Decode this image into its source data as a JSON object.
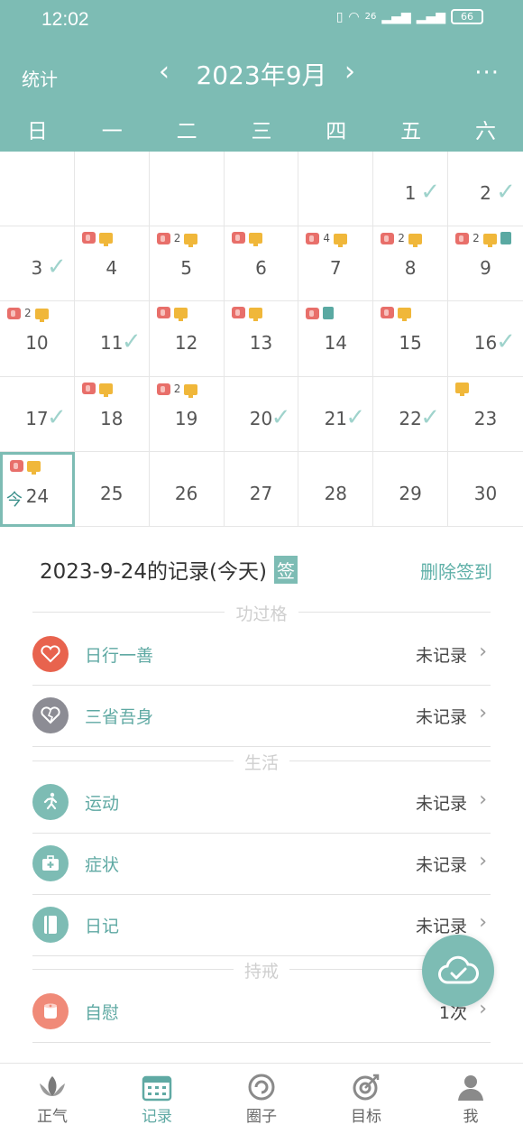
{
  "status_bar": {
    "time": "12:02",
    "signal": "26",
    "battery": "66"
  },
  "header": {
    "stats_label": "统计",
    "month_title": "2023年9月",
    "prev": "‹",
    "next": "›",
    "more": "···"
  },
  "weekdays": [
    "日",
    "一",
    "二",
    "三",
    "四",
    "五",
    "六"
  ],
  "calendar": {
    "days": [
      {
        "n": "",
        "check": false,
        "markers": []
      },
      {
        "n": "",
        "check": false,
        "markers": []
      },
      {
        "n": "",
        "check": false,
        "markers": []
      },
      {
        "n": "",
        "check": false,
        "markers": []
      },
      {
        "n": "",
        "check": false,
        "markers": []
      },
      {
        "n": "1",
        "check": true,
        "markers": []
      },
      {
        "n": "2",
        "check": true,
        "markers": []
      },
      {
        "n": "3",
        "check": true,
        "markers": []
      },
      {
        "n": "4",
        "check": false,
        "markers": [
          "red",
          "yellow"
        ]
      },
      {
        "n": "5",
        "check": false,
        "markers": [
          "red",
          "2",
          "yellow"
        ]
      },
      {
        "n": "6",
        "check": false,
        "markers": [
          "red",
          "yellow"
        ]
      },
      {
        "n": "7",
        "check": false,
        "markers": [
          "red",
          "4",
          "yellow"
        ]
      },
      {
        "n": "8",
        "check": false,
        "markers": [
          "red",
          "2",
          "yellow"
        ]
      },
      {
        "n": "9",
        "check": false,
        "markers": [
          "red",
          "2",
          "yellow",
          "teal"
        ]
      },
      {
        "n": "10",
        "check": false,
        "markers": [
          "red",
          "2",
          "yellow"
        ]
      },
      {
        "n": "11",
        "check": true,
        "markers": []
      },
      {
        "n": "12",
        "check": false,
        "markers": [
          "red",
          "yellow"
        ]
      },
      {
        "n": "13",
        "check": false,
        "markers": [
          "red",
          "yellow"
        ]
      },
      {
        "n": "14",
        "check": false,
        "markers": [
          "red",
          "teal"
        ]
      },
      {
        "n": "15",
        "check": false,
        "markers": [
          "red",
          "yellow"
        ]
      },
      {
        "n": "16",
        "check": true,
        "markers": []
      },
      {
        "n": "17",
        "check": true,
        "markers": []
      },
      {
        "n": "18",
        "check": false,
        "markers": [
          "red",
          "yellow"
        ]
      },
      {
        "n": "19",
        "check": false,
        "markers": [
          "red",
          "2",
          "yellow"
        ]
      },
      {
        "n": "20",
        "check": true,
        "markers": []
      },
      {
        "n": "21",
        "check": true,
        "markers": []
      },
      {
        "n": "22",
        "check": true,
        "markers": []
      },
      {
        "n": "23",
        "check": false,
        "markers": [
          "yellow"
        ]
      },
      {
        "n": "24",
        "check": false,
        "today": true,
        "today_label": "今",
        "markers": [
          "red",
          "yellow"
        ]
      },
      {
        "n": "25",
        "check": false,
        "markers": []
      },
      {
        "n": "26",
        "check": false,
        "markers": []
      },
      {
        "n": "27",
        "check": false,
        "markers": []
      },
      {
        "n": "28",
        "check": false,
        "markers": []
      },
      {
        "n": "29",
        "check": false,
        "markers": []
      },
      {
        "n": "30",
        "check": false,
        "markers": []
      }
    ]
  },
  "record": {
    "title": "2023-9-24的记录(今天)",
    "sign_badge": "签",
    "delete_label": "删除签到"
  },
  "sections": {
    "merit": "功过格",
    "life": "生活",
    "precept": "持戒"
  },
  "rows": {
    "good_deed": {
      "label": "日行一善",
      "value": "未记录"
    },
    "reflect": {
      "label": "三省吾身",
      "value": "未记录"
    },
    "exercise": {
      "label": "运动",
      "value": "未记录"
    },
    "symptom": {
      "label": "症状",
      "value": "未记录"
    },
    "diary": {
      "label": "日记",
      "value": "未记录"
    },
    "abstain": {
      "label": "自慰",
      "value": "1次"
    }
  },
  "colors": {
    "primary": "#7dbcb4",
    "heart_red": "#e8634e",
    "grey": "#8c8c94",
    "salmon": "#f08a78"
  },
  "nav": [
    "正气",
    "记录",
    "圈子",
    "目标",
    "我"
  ]
}
